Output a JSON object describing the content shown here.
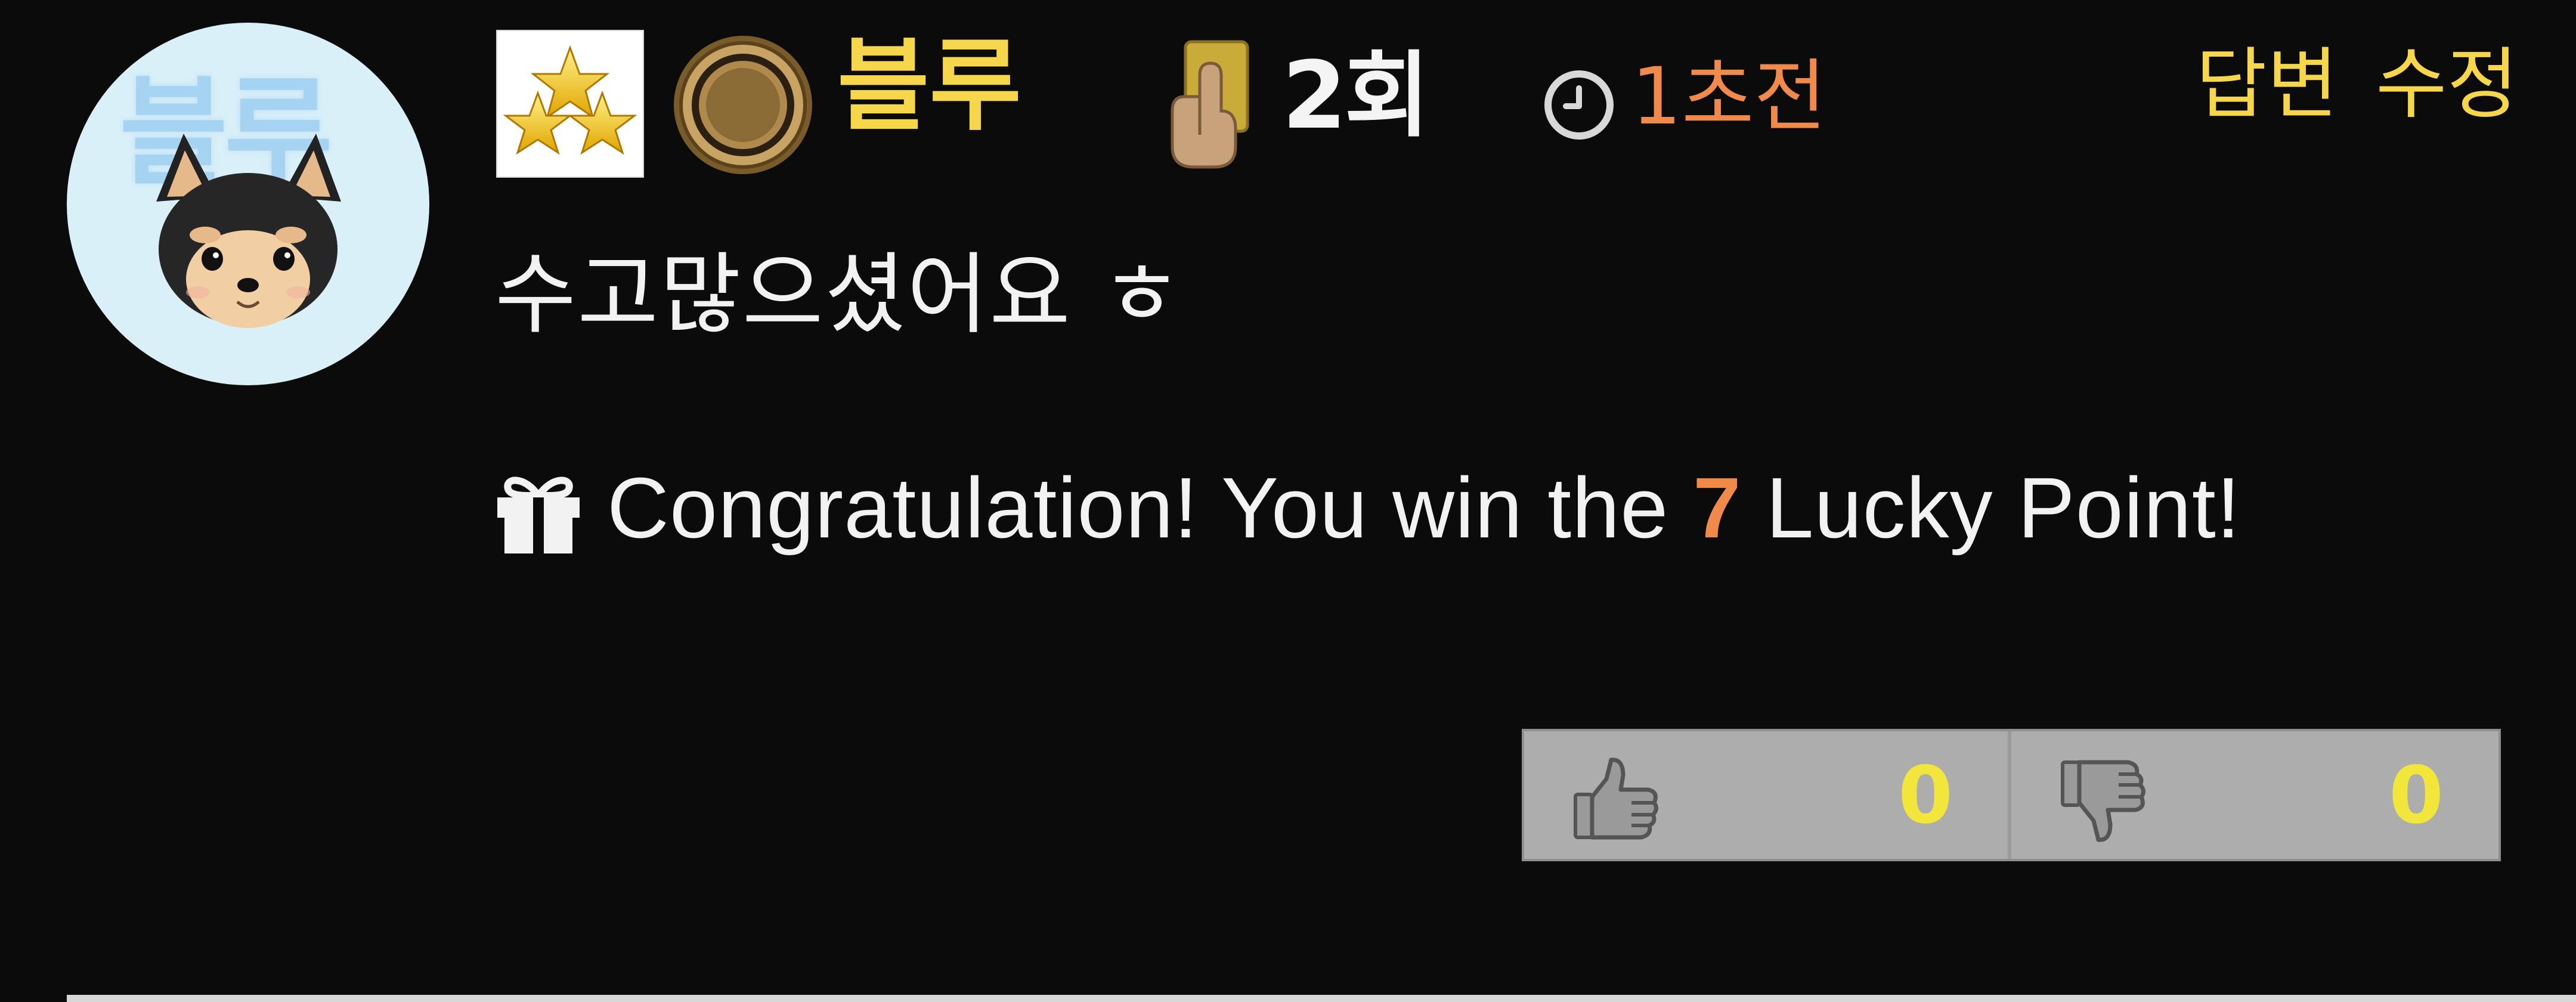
{
  "user": {
    "avatar_text": "블루",
    "nickname": "블루",
    "count_label": "2회"
  },
  "meta": {
    "time_ago": "1초전"
  },
  "actions": {
    "reply_label": "답변",
    "edit_label": "수정"
  },
  "comment": {
    "text": "수고많으셨어요 ㅎ",
    "lucky_prefix": "Congratulation! You win the ",
    "lucky_points": "7",
    "lucky_suffix": " Lucky Point!"
  },
  "votes": {
    "up_count": "0",
    "down_count": "0"
  },
  "icons": {
    "rank": "three-stars-rank-icon",
    "medal": "bronze-medal-icon",
    "card": "yellow-card-icon",
    "clock": "clock-icon",
    "gift": "gift-icon",
    "thumb_up": "thumbs-up-icon",
    "thumb_down": "thumbs-down-icon"
  },
  "colors": {
    "background": "#0b0b0b",
    "nickname": "#f6d64a",
    "time_ago": "#f08a4b",
    "actions": "#f6d64a",
    "lucky_points": "#f08a4b",
    "vote_count": "#f2e63c",
    "vote_bg": "#adadad"
  }
}
